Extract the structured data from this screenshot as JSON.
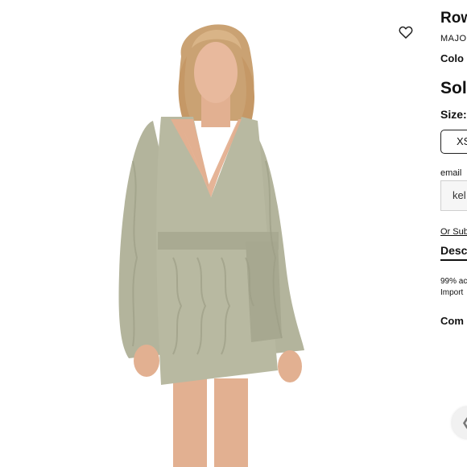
{
  "product": {
    "title": "Row",
    "brand": "MAJO",
    "color_label": "Colo",
    "price": "Sol",
    "size_label": "Size:",
    "size_option": "XS",
    "email_label": "email",
    "email_value": "kel",
    "subscribe_link": "Or Sub",
    "description_tab": "Desc",
    "description_line1": "99% ac",
    "description_line2": "Import",
    "composition_label": "Com"
  },
  "icons": {
    "wishlist": "heart-outline-icon",
    "scroll": "chevron-left-icon"
  },
  "colors": {
    "dress": "#b3b49c",
    "skin": "#e6b69a",
    "hair": "#caa273",
    "border": "#222222"
  }
}
